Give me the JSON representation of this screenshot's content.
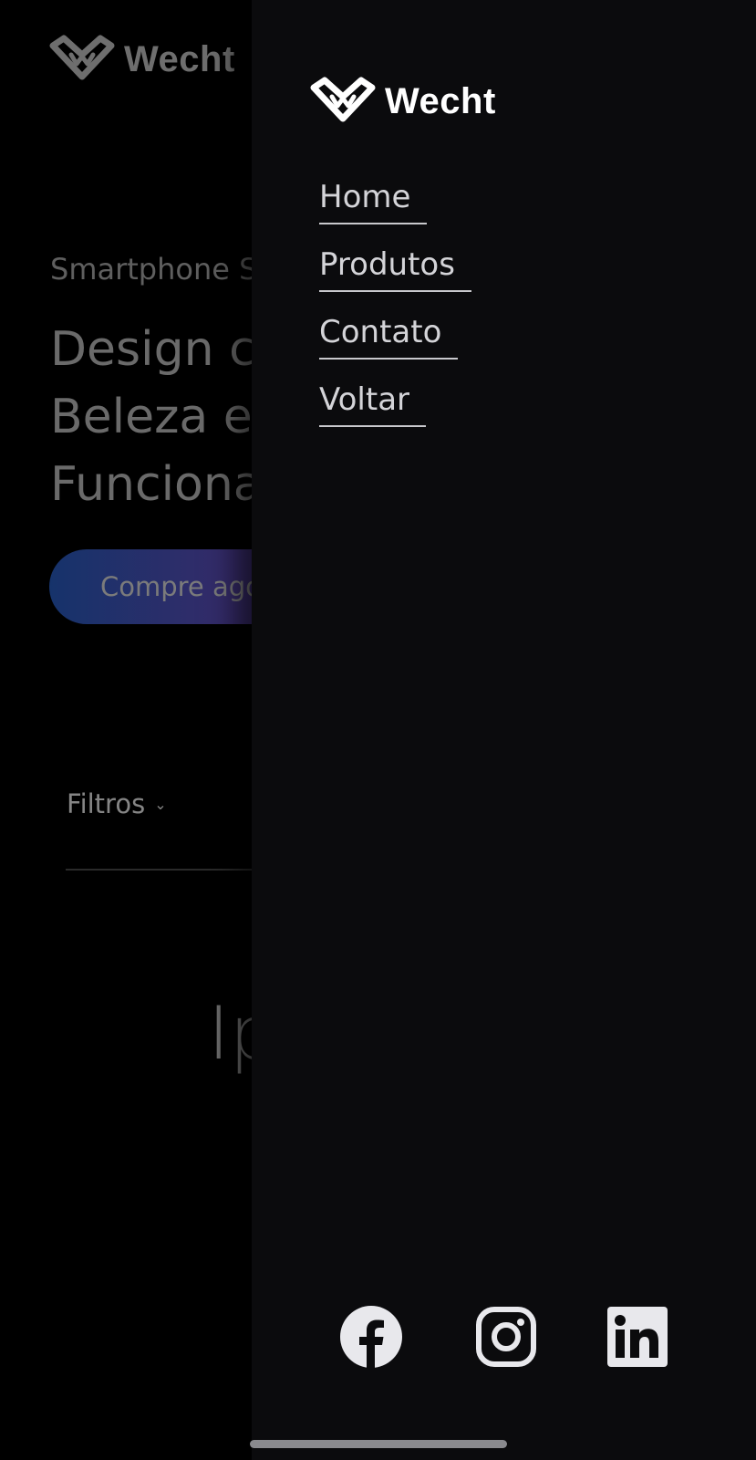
{
  "brand": {
    "name": "Wecht"
  },
  "background": {
    "subtitle": "Smartphone S",
    "heading_lines": [
      "Design co",
      "Beleza e",
      "Funciona"
    ],
    "cta_label": "Compre ago",
    "filters_label": "Filtros",
    "product_title_partial": "Ip"
  },
  "drawer": {
    "nav": [
      {
        "label": "Home"
      },
      {
        "label": "Produtos"
      },
      {
        "label": "Contato"
      },
      {
        "label": "Voltar"
      }
    ],
    "social": [
      "facebook-icon",
      "instagram-icon",
      "linkedin-icon"
    ]
  },
  "colors": {
    "drawer_bg": "#0b0b0d",
    "nav_text": "#d4d4d8",
    "cta_gradient_start": "#16336b",
    "cta_gradient_end": "#7a2b79"
  }
}
